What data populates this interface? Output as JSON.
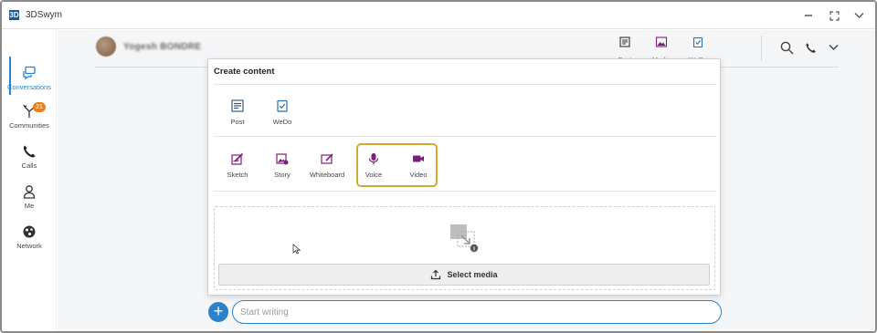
{
  "app": {
    "title": "3DSwym",
    "logo": "3D"
  },
  "window_controls": {
    "minimize": "minimize-icon",
    "fullscreen": "fullscreen-icon",
    "menu": "chevron-down-icon"
  },
  "sidebar": {
    "items": [
      {
        "label": "Conversations",
        "icon": "chat-icon",
        "active": true
      },
      {
        "label": "Communities",
        "icon": "communities-icon",
        "badge": "21"
      },
      {
        "label": "Calls",
        "icon": "phone-icon"
      },
      {
        "label": "Me",
        "icon": "user-icon"
      },
      {
        "label": "Network",
        "icon": "network-icon"
      }
    ]
  },
  "header": {
    "user_name": "Yogesh BONDRE",
    "actions": [
      {
        "label": "Post",
        "icon": "post-icon"
      },
      {
        "label": "Media",
        "icon": "media-icon"
      },
      {
        "label": "WeDo",
        "icon": "wedo-icon"
      }
    ]
  },
  "create_content": {
    "title": "Create content",
    "row1": [
      {
        "label": "Post",
        "icon": "post-icon"
      },
      {
        "label": "WeDo",
        "icon": "wedo-icon"
      }
    ],
    "row2": [
      {
        "label": "Sketch",
        "icon": "sketch-icon"
      },
      {
        "label": "Story",
        "icon": "story-icon"
      },
      {
        "label": "Whiteboard",
        "icon": "whiteboard-icon"
      },
      {
        "label": "Voice",
        "icon": "microphone-icon"
      },
      {
        "label": "Video",
        "icon": "video-camera-icon"
      }
    ],
    "select_media_label": "Select media"
  },
  "compose": {
    "placeholder": "Start writing"
  },
  "colors": {
    "accent": "#2b82c9",
    "purple": "#7b1f7a",
    "highlight": "#d4a837",
    "badge": "#e8811a",
    "post_icon": "#3d5a78"
  }
}
